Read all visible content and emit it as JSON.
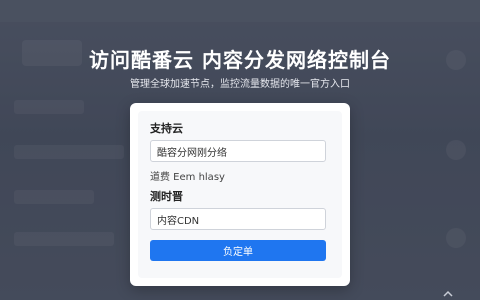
{
  "hero": {
    "title": "访问酷番云 内容分发网络控制台",
    "subtitle": "管理全球加速节点，监控流量数据的唯一官方入口"
  },
  "form": {
    "section1_label": "支持云",
    "field1_value": "酷容分网刚分络",
    "meta_text": "道费 Eem hlasy",
    "section2_label": "测时晋",
    "field2_value": "内容CDN",
    "submit_label": "负定单"
  },
  "icons": {
    "scroll_indicator": "chevron-up-icon"
  },
  "colors": {
    "overlay_bg": "#4b5264",
    "primary": "#1f76f0",
    "card_bg": "#ffffff"
  }
}
